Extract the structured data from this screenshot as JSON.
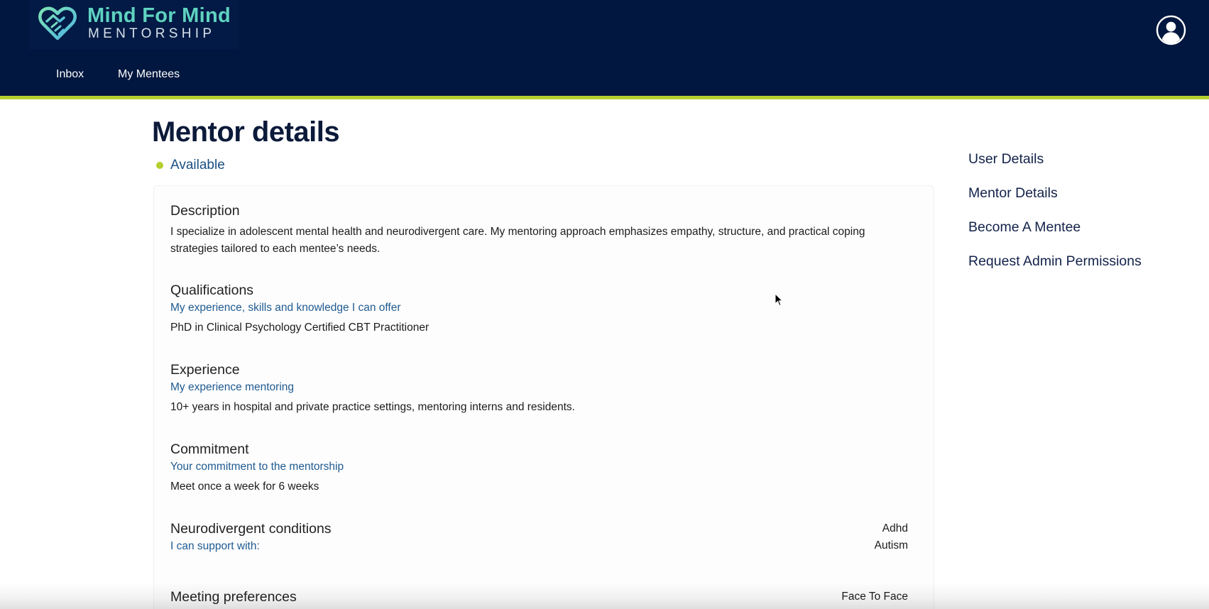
{
  "header": {
    "logo_title": "Mind For Mind",
    "logo_subtitle": "MENTORSHIP",
    "nav": {
      "inbox": "Inbox",
      "my_mentees": "My Mentees"
    },
    "avatar_icon": "user-circle-icon",
    "colors": {
      "background": "#01173f",
      "accent": "#b6cf2e",
      "logo": "#5fd3c0"
    }
  },
  "main": {
    "title": "Mentor details",
    "status": {
      "label": "Available",
      "color": "#b6cf2e"
    },
    "description": {
      "heading": "Description",
      "text": "I specialize in adolescent mental health and neurodivergent care. My mentoring approach emphasizes empathy, structure, and practical coping strategies tailored to each mentee’s needs."
    },
    "qualifications": {
      "heading": "Qualifications",
      "subtitle": "My experience, skills and knowledge I can offer",
      "text": "PhD in Clinical Psychology Certified CBT Practitioner"
    },
    "experience": {
      "heading": "Experience",
      "subtitle": "My experience mentoring",
      "text": "10+ years in hospital and private practice settings, mentoring interns and residents."
    },
    "commitment": {
      "heading": "Commitment",
      "subtitle": "Your commitment to the mentorship",
      "text": "Meet once a week for 6 weeks"
    },
    "neurodivergent": {
      "heading": "Neurodivergent conditions",
      "subtitle": "I can support with:",
      "values": [
        "Adhd",
        "Autism"
      ]
    },
    "meeting": {
      "heading": "Meeting preferences",
      "values": [
        "Face To Face"
      ]
    }
  },
  "sidebar": {
    "items": [
      {
        "label": "User Details"
      },
      {
        "label": "Mentor Details"
      },
      {
        "label": "Become A Mentee"
      },
      {
        "label": "Request Admin Permissions"
      }
    ]
  }
}
